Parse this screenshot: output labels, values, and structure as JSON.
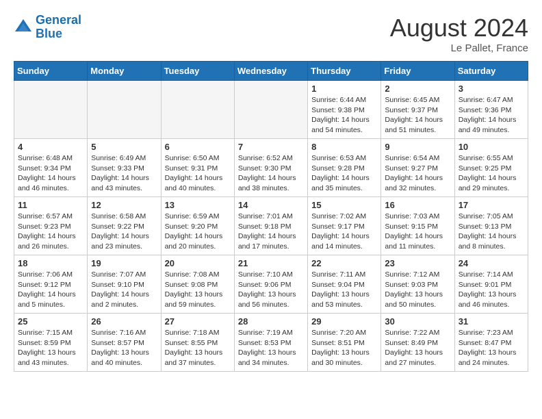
{
  "header": {
    "logo_line1": "General",
    "logo_line2": "Blue",
    "month_year": "August 2024",
    "location": "Le Pallet, France"
  },
  "weekdays": [
    "Sunday",
    "Monday",
    "Tuesday",
    "Wednesday",
    "Thursday",
    "Friday",
    "Saturday"
  ],
  "weeks": [
    [
      {
        "day": "",
        "info": "",
        "empty": true
      },
      {
        "day": "",
        "info": "",
        "empty": true
      },
      {
        "day": "",
        "info": "",
        "empty": true
      },
      {
        "day": "",
        "info": "",
        "empty": true
      },
      {
        "day": "1",
        "info": "Sunrise: 6:44 AM\nSunset: 9:38 PM\nDaylight: 14 hours\nand 54 minutes."
      },
      {
        "day": "2",
        "info": "Sunrise: 6:45 AM\nSunset: 9:37 PM\nDaylight: 14 hours\nand 51 minutes."
      },
      {
        "day": "3",
        "info": "Sunrise: 6:47 AM\nSunset: 9:36 PM\nDaylight: 14 hours\nand 49 minutes."
      }
    ],
    [
      {
        "day": "4",
        "info": "Sunrise: 6:48 AM\nSunset: 9:34 PM\nDaylight: 14 hours\nand 46 minutes."
      },
      {
        "day": "5",
        "info": "Sunrise: 6:49 AM\nSunset: 9:33 PM\nDaylight: 14 hours\nand 43 minutes."
      },
      {
        "day": "6",
        "info": "Sunrise: 6:50 AM\nSunset: 9:31 PM\nDaylight: 14 hours\nand 40 minutes."
      },
      {
        "day": "7",
        "info": "Sunrise: 6:52 AM\nSunset: 9:30 PM\nDaylight: 14 hours\nand 38 minutes."
      },
      {
        "day": "8",
        "info": "Sunrise: 6:53 AM\nSunset: 9:28 PM\nDaylight: 14 hours\nand 35 minutes."
      },
      {
        "day": "9",
        "info": "Sunrise: 6:54 AM\nSunset: 9:27 PM\nDaylight: 14 hours\nand 32 minutes."
      },
      {
        "day": "10",
        "info": "Sunrise: 6:55 AM\nSunset: 9:25 PM\nDaylight: 14 hours\nand 29 minutes."
      }
    ],
    [
      {
        "day": "11",
        "info": "Sunrise: 6:57 AM\nSunset: 9:23 PM\nDaylight: 14 hours\nand 26 minutes."
      },
      {
        "day": "12",
        "info": "Sunrise: 6:58 AM\nSunset: 9:22 PM\nDaylight: 14 hours\nand 23 minutes."
      },
      {
        "day": "13",
        "info": "Sunrise: 6:59 AM\nSunset: 9:20 PM\nDaylight: 14 hours\nand 20 minutes."
      },
      {
        "day": "14",
        "info": "Sunrise: 7:01 AM\nSunset: 9:18 PM\nDaylight: 14 hours\nand 17 minutes."
      },
      {
        "day": "15",
        "info": "Sunrise: 7:02 AM\nSunset: 9:17 PM\nDaylight: 14 hours\nand 14 minutes."
      },
      {
        "day": "16",
        "info": "Sunrise: 7:03 AM\nSunset: 9:15 PM\nDaylight: 14 hours\nand 11 minutes."
      },
      {
        "day": "17",
        "info": "Sunrise: 7:05 AM\nSunset: 9:13 PM\nDaylight: 14 hours\nand 8 minutes."
      }
    ],
    [
      {
        "day": "18",
        "info": "Sunrise: 7:06 AM\nSunset: 9:12 PM\nDaylight: 14 hours\nand 5 minutes."
      },
      {
        "day": "19",
        "info": "Sunrise: 7:07 AM\nSunset: 9:10 PM\nDaylight: 14 hours\nand 2 minutes."
      },
      {
        "day": "20",
        "info": "Sunrise: 7:08 AM\nSunset: 9:08 PM\nDaylight: 13 hours\nand 59 minutes."
      },
      {
        "day": "21",
        "info": "Sunrise: 7:10 AM\nSunset: 9:06 PM\nDaylight: 13 hours\nand 56 minutes."
      },
      {
        "day": "22",
        "info": "Sunrise: 7:11 AM\nSunset: 9:04 PM\nDaylight: 13 hours\nand 53 minutes."
      },
      {
        "day": "23",
        "info": "Sunrise: 7:12 AM\nSunset: 9:03 PM\nDaylight: 13 hours\nand 50 minutes."
      },
      {
        "day": "24",
        "info": "Sunrise: 7:14 AM\nSunset: 9:01 PM\nDaylight: 13 hours\nand 46 minutes."
      }
    ],
    [
      {
        "day": "25",
        "info": "Sunrise: 7:15 AM\nSunset: 8:59 PM\nDaylight: 13 hours\nand 43 minutes."
      },
      {
        "day": "26",
        "info": "Sunrise: 7:16 AM\nSunset: 8:57 PM\nDaylight: 13 hours\nand 40 minutes."
      },
      {
        "day": "27",
        "info": "Sunrise: 7:18 AM\nSunset: 8:55 PM\nDaylight: 13 hours\nand 37 minutes."
      },
      {
        "day": "28",
        "info": "Sunrise: 7:19 AM\nSunset: 8:53 PM\nDaylight: 13 hours\nand 34 minutes."
      },
      {
        "day": "29",
        "info": "Sunrise: 7:20 AM\nSunset: 8:51 PM\nDaylight: 13 hours\nand 30 minutes."
      },
      {
        "day": "30",
        "info": "Sunrise: 7:22 AM\nSunset: 8:49 PM\nDaylight: 13 hours\nand 27 minutes."
      },
      {
        "day": "31",
        "info": "Sunrise: 7:23 AM\nSunset: 8:47 PM\nDaylight: 13 hours\nand 24 minutes."
      }
    ]
  ]
}
